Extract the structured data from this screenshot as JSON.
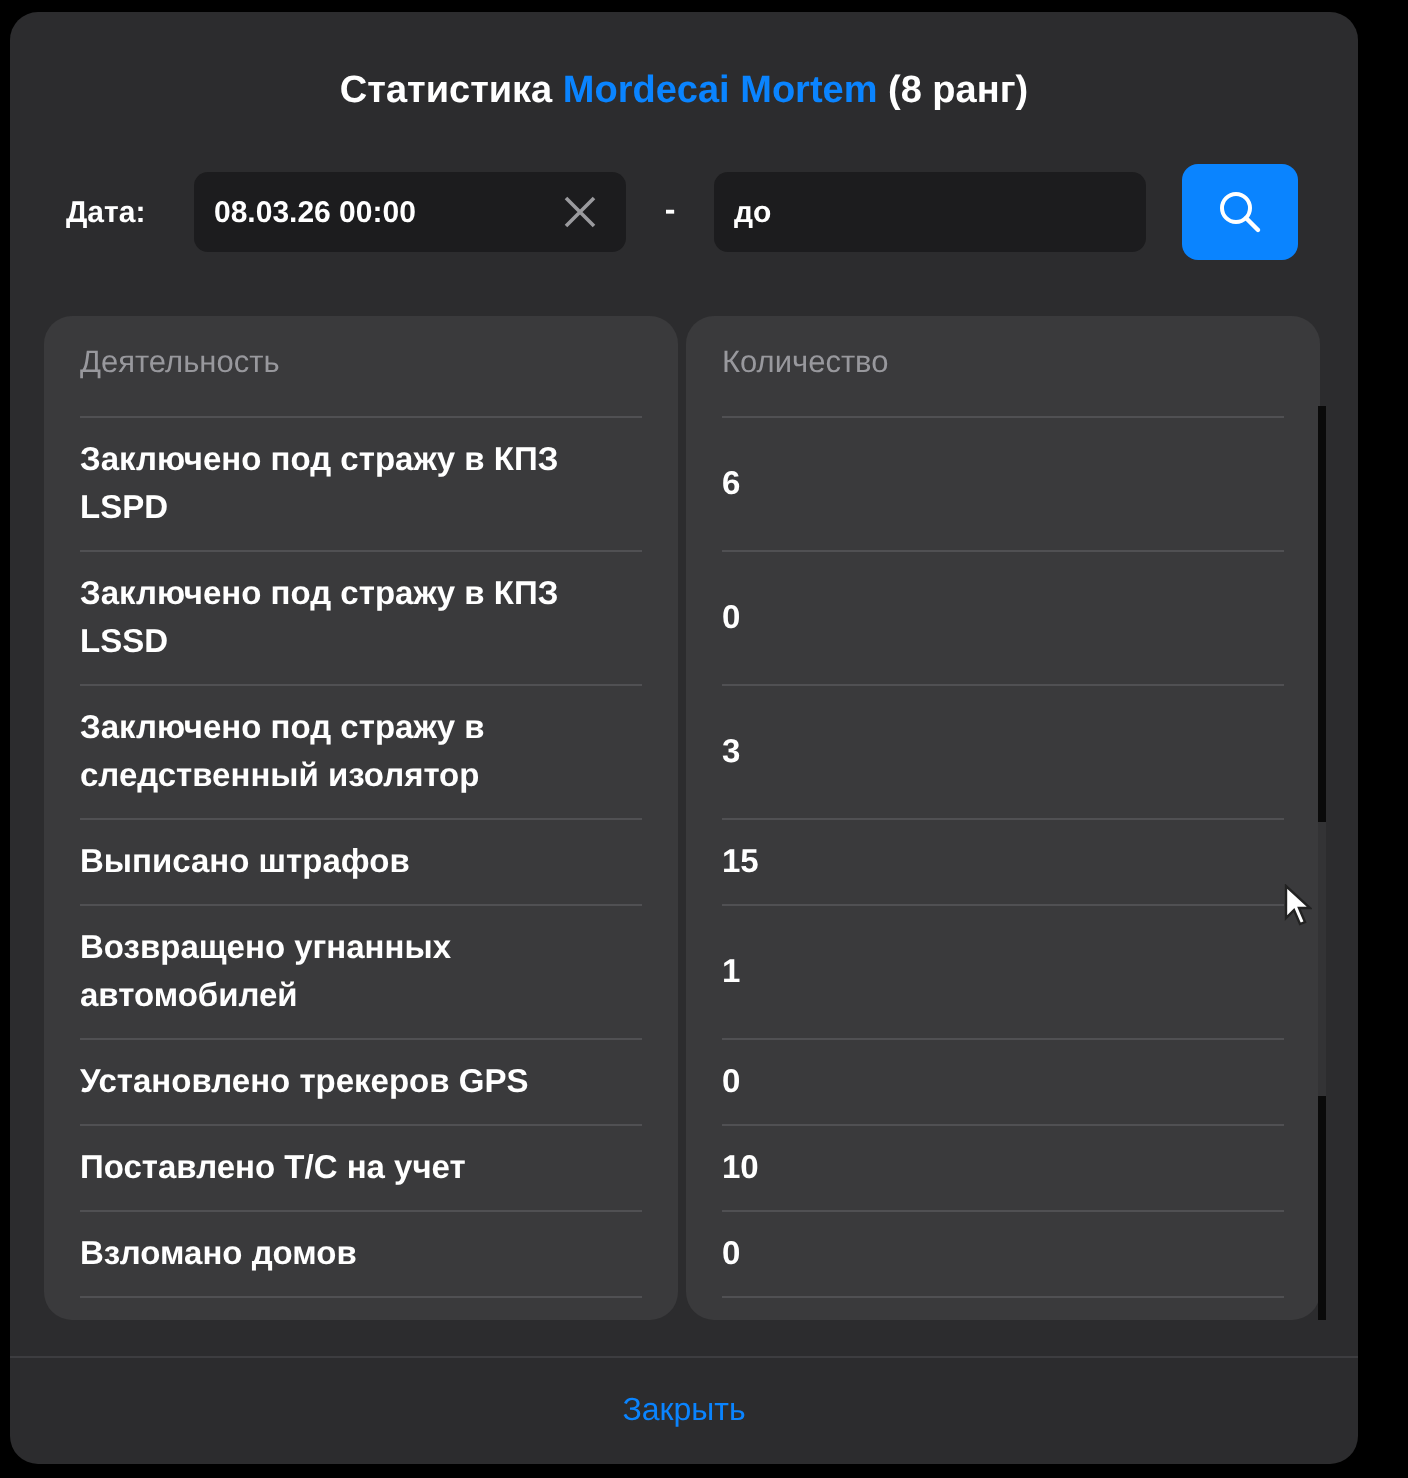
{
  "dialog": {
    "title": {
      "prefix": "Статистика",
      "name": "Mordecai Mortem",
      "suffix": "(8 ранг)"
    },
    "filter": {
      "label": "Дата:",
      "from": {
        "value": "08.03.26 00:00"
      },
      "separator": "-",
      "to": {
        "placeholder": "до"
      }
    },
    "table": {
      "columns": [
        "Деятельность",
        "Количество"
      ],
      "rows": [
        {
          "activity": "Заключено под стражу в КПЗ LSPD",
          "count": "6"
        },
        {
          "activity": "Заключено под стражу в КПЗ LSSD",
          "count": "0"
        },
        {
          "activity": "Заключено под стражу в следственный изолятор",
          "count": "3"
        },
        {
          "activity": "Выписано штрафов",
          "count": "15"
        },
        {
          "activity": "Возвращено угнанных автомобилей",
          "count": "1"
        },
        {
          "activity": "Установлено трекеров GPS",
          "count": "0"
        },
        {
          "activity": "Поставлено Т/С на учет",
          "count": "10"
        },
        {
          "activity": "Взломано домов",
          "count": "0"
        }
      ]
    },
    "close_button": "Закрыть"
  }
}
